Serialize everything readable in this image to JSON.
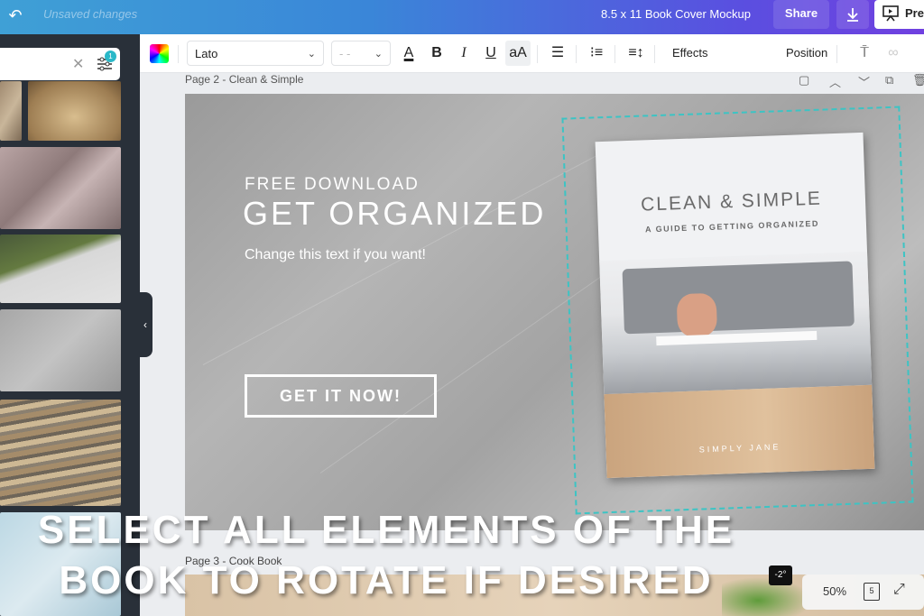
{
  "topbar": {
    "undo_icon": "undo-icon",
    "status": "Unsaved changes",
    "document_title": "8.5 x 11 Book Cover Mockup",
    "share_label": "Share",
    "download_icon": "download-icon",
    "present_label": "Pre"
  },
  "sidebar": {
    "search_value": "",
    "filter_badge": "1",
    "thumbnails": [
      "striped stone",
      "buddha statue",
      "granite blocks",
      "granite steps with grass",
      "grey marble",
      "layered rock",
      "light blue marble"
    ]
  },
  "toolbar": {
    "font": "Lato",
    "font_size": "- -",
    "bold": "B",
    "italic": "I",
    "underline": "U",
    "case": "aA",
    "effects_label": "Effects",
    "position_label": "Position"
  },
  "page2": {
    "label": "Page 2 - Clean & Simple",
    "free_download": "FREE DOWNLOAD",
    "headline": "GET ORGANIZED",
    "subtext": "Change this text if you want!",
    "cta": "GET IT NOW!",
    "book": {
      "title": "CLEAN & SIMPLE",
      "subtitle": "A GUIDE TO GETTING ORGANIZED",
      "author": "SIMPLY JANE"
    }
  },
  "page3": {
    "label": "Page 3 - Cook Book"
  },
  "rotation_tooltip": "-2°",
  "footer": {
    "zoom": "50%",
    "page_count": "5"
  },
  "caption": {
    "line1": "SELECT ALL ELEMENTS OF THE",
    "line2": "BOOK TO ROTATE IF DESIRED"
  },
  "colors": {
    "selection": "#3cc4c4",
    "sidebar": "#293039",
    "badge": "#2ab8c8"
  }
}
